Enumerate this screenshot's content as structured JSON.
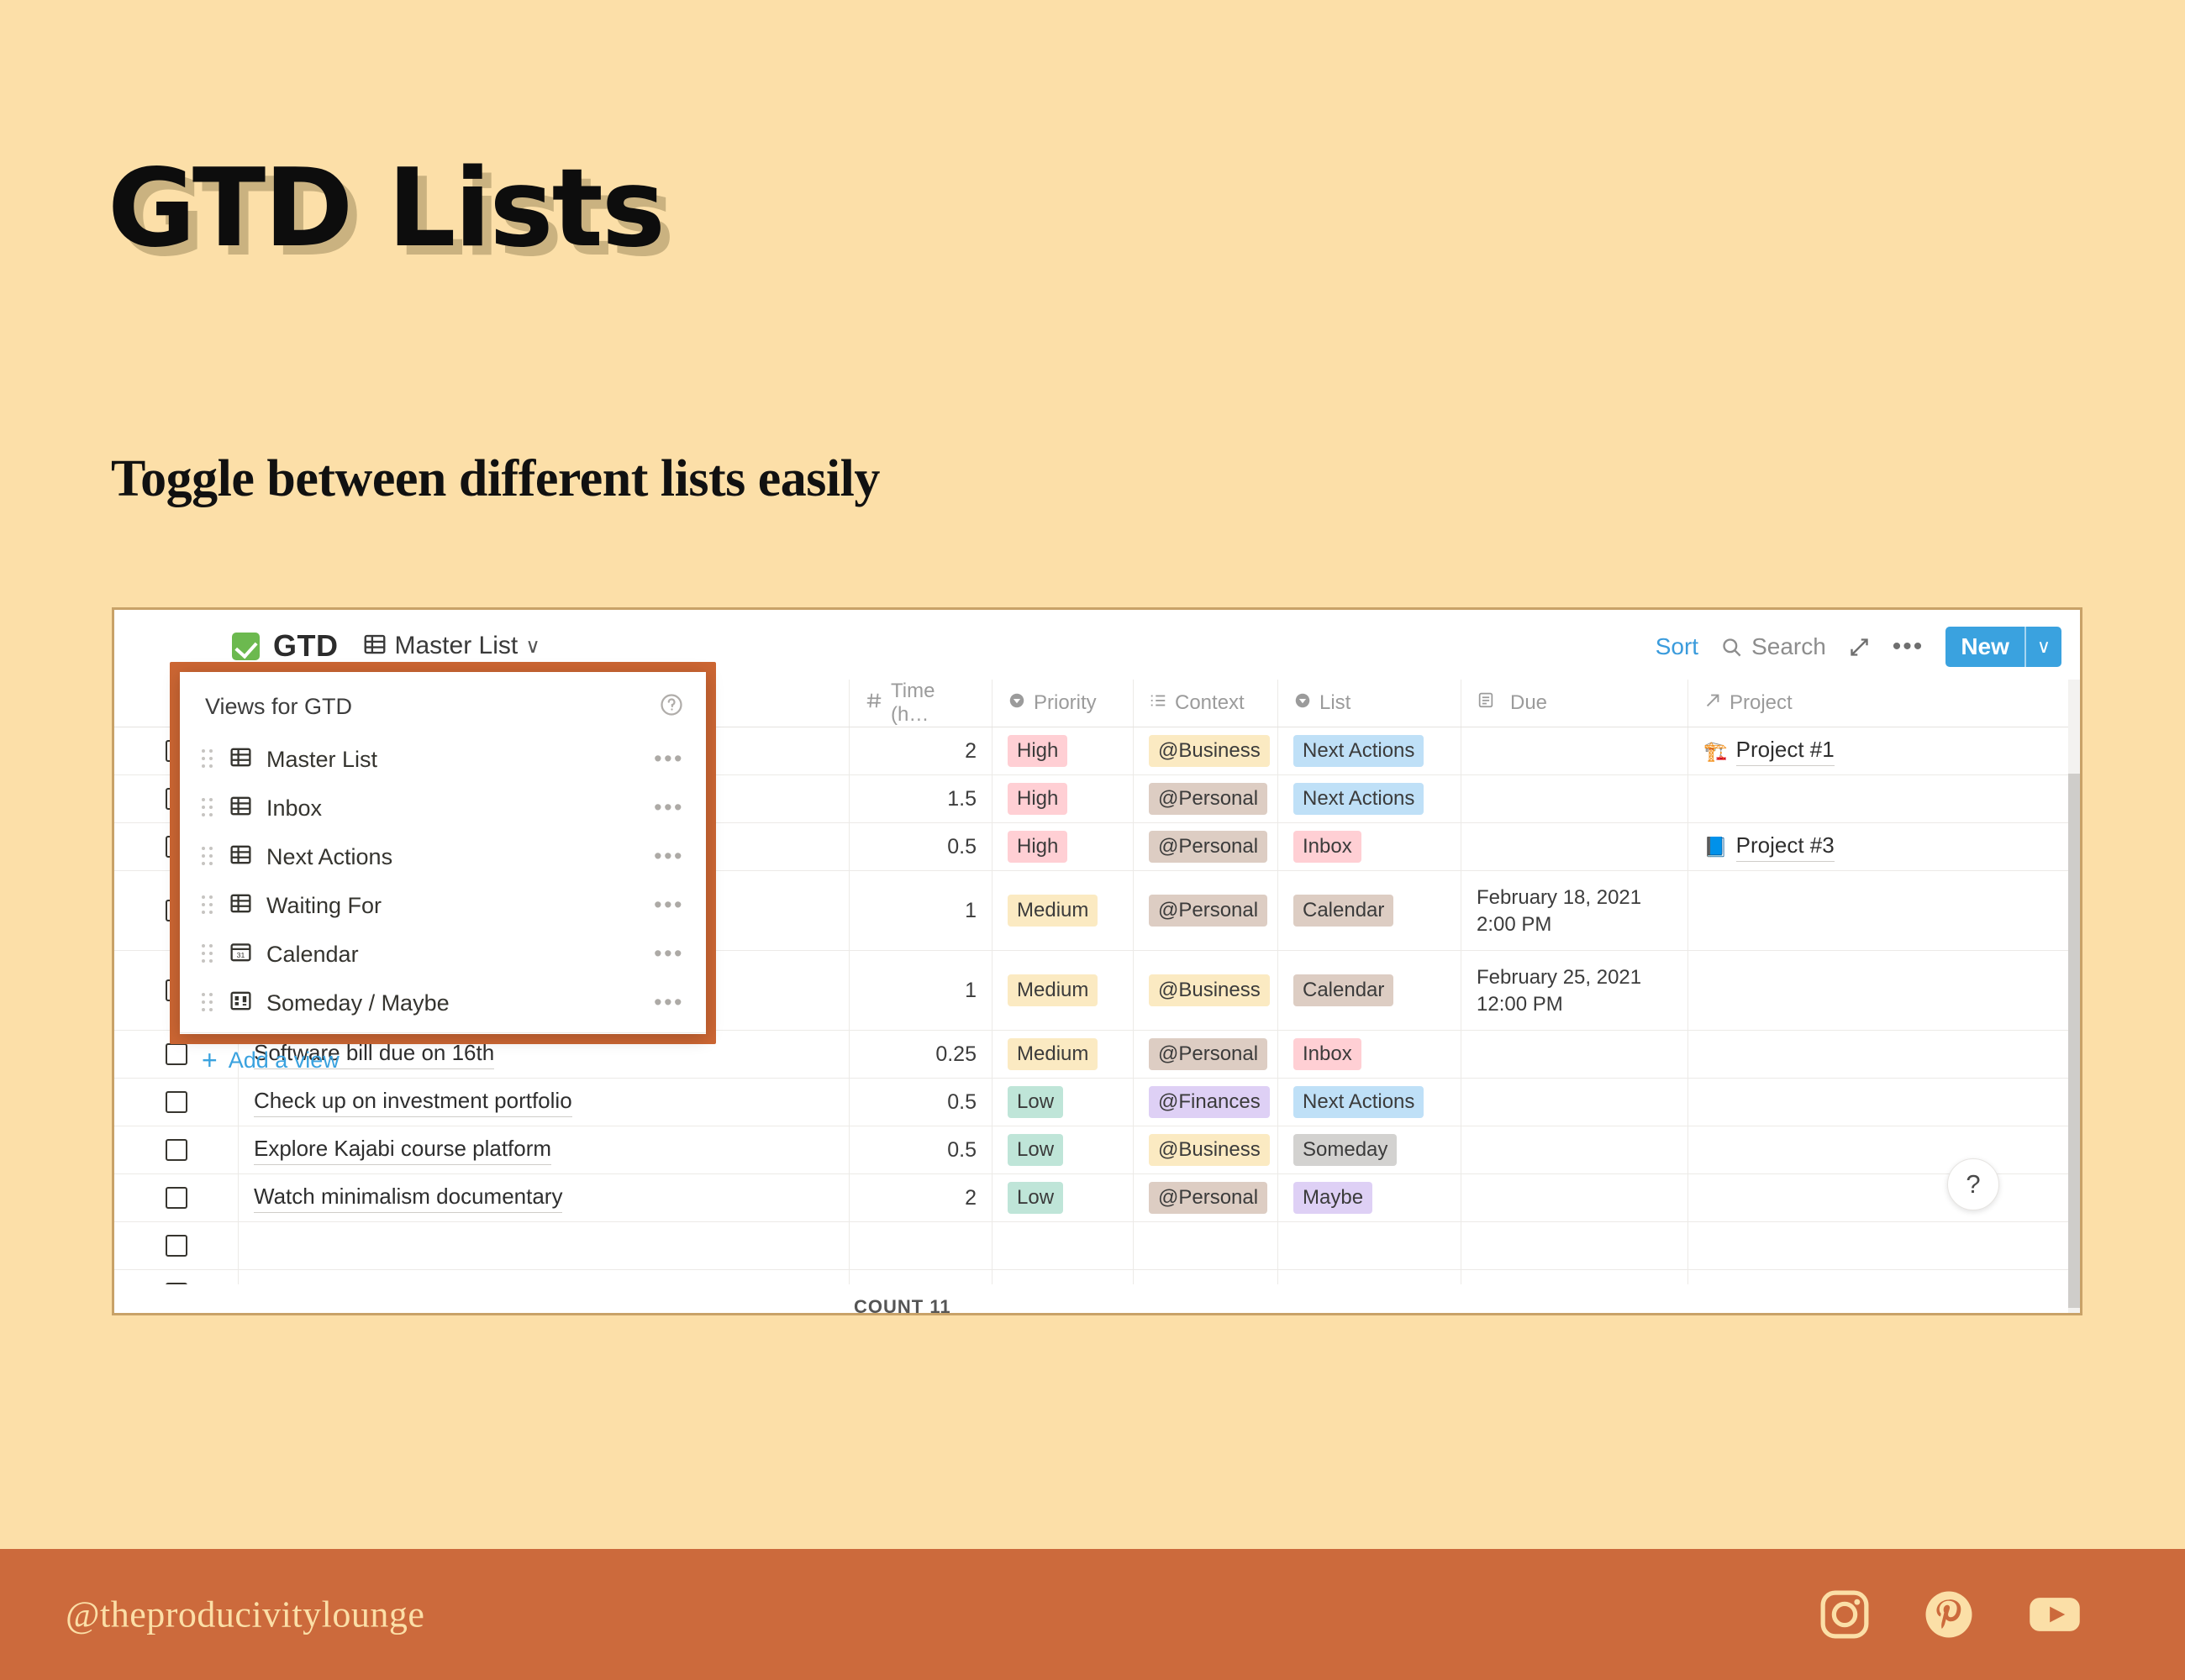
{
  "slide": {
    "title": "GTD Lists",
    "subtitle": "Toggle between different lists easily",
    "background_color": "#fcdfa8",
    "footer_color": "#cc6a3c",
    "highlight_color": "#cc6633"
  },
  "app": {
    "db_emoji": "white-check-mark",
    "db_title": "GTD",
    "current_view": "Master List",
    "view_caret": "∨"
  },
  "toolbar": {
    "sort_label": "Sort",
    "search_label": "Search",
    "expand_icon": "expand-arrows-icon",
    "more_label": "•••",
    "new_label": "New",
    "new_caret": "∨"
  },
  "views_dropdown": {
    "heading": "Views for GTD",
    "help_icon": "question-circle-icon",
    "items": [
      {
        "label": "Master List",
        "icon": "table-view-icon",
        "menu": "•••"
      },
      {
        "label": "Inbox",
        "icon": "table-view-icon",
        "menu": "•••"
      },
      {
        "label": "Next Actions",
        "icon": "table-view-icon",
        "menu": "•••"
      },
      {
        "label": "Waiting For",
        "icon": "table-view-icon",
        "menu": "•••"
      },
      {
        "label": "Calendar",
        "icon": "calendar-view-icon",
        "menu": "•••"
      },
      {
        "label": "Someday / Maybe",
        "icon": "board-view-icon",
        "menu": "•••"
      }
    ],
    "add_view_label": "Add a view",
    "add_view_plus": "+"
  },
  "table": {
    "columns": [
      {
        "label": "",
        "icon": ""
      },
      {
        "label": "",
        "icon": ""
      },
      {
        "label": "Time (h…",
        "icon": "number-icon"
      },
      {
        "label": "Priority",
        "icon": "select-icon"
      },
      {
        "label": "Context",
        "icon": "multiselect-icon"
      },
      {
        "label": "List",
        "icon": "select-icon"
      },
      {
        "label": "Due",
        "icon": "date-icon"
      },
      {
        "label": "Project",
        "icon": "relation-icon"
      }
    ],
    "rows": [
      {
        "name": "",
        "hidden_name": true,
        "time": "2",
        "priority": "High",
        "priority_color": "tg-pink",
        "context": "@Business",
        "context_color": "tg-yellow",
        "list": "Next Actions",
        "list_color": "tg-blue",
        "due": "",
        "project": "Project #1",
        "project_emoji": "🏗️",
        "tall": false
      },
      {
        "name": "",
        "hidden_name": true,
        "time": "1.5",
        "priority": "High",
        "priority_color": "tg-pink",
        "context": "@Personal",
        "context_color": "tg-brown",
        "list": "Next Actions",
        "list_color": "tg-blue",
        "due": "",
        "project": "",
        "project_emoji": "",
        "tall": false
      },
      {
        "name": "",
        "hidden_name": true,
        "time": "0.5",
        "priority": "High",
        "priority_color": "tg-pink",
        "context": "@Personal",
        "context_color": "tg-brown",
        "list": "Inbox",
        "list_color": "tg-pink",
        "due": "",
        "project": "Project #3",
        "project_emoji": "📘",
        "tall": false
      },
      {
        "name": "",
        "hidden_name": true,
        "time": "1",
        "priority": "Medium",
        "priority_color": "tg-yellow",
        "context": "@Personal",
        "context_color": "tg-brown",
        "list": "Calendar",
        "list_color": "tg-brown",
        "due": "February 18, 2021 2:00 PM",
        "project": "",
        "project_emoji": "",
        "tall": true
      },
      {
        "name": "",
        "hidden_name": true,
        "time": "1",
        "priority": "Medium",
        "priority_color": "tg-yellow",
        "context": "@Business",
        "context_color": "tg-yellow",
        "list": "Calendar",
        "list_color": "tg-brown",
        "due": "February 25, 2021 12:00 PM",
        "project": "",
        "project_emoji": "",
        "tall": true
      },
      {
        "name": "Software bill due on 16th",
        "hidden_name": false,
        "time": "0.25",
        "priority": "Medium",
        "priority_color": "tg-yellow",
        "context": "@Personal",
        "context_color": "tg-brown",
        "list": "Inbox",
        "list_color": "tg-pink",
        "due": "",
        "project": "",
        "project_emoji": "",
        "tall": false
      },
      {
        "name": "Check up on investment portfolio",
        "hidden_name": false,
        "time": "0.5",
        "priority": "Low",
        "priority_color": "tg-green",
        "context": "@Finances",
        "context_color": "tg-purple",
        "list": "Next Actions",
        "list_color": "tg-blue",
        "due": "",
        "project": "",
        "project_emoji": "",
        "tall": false
      },
      {
        "name": "Explore Kajabi course platform",
        "hidden_name": false,
        "time": "0.5",
        "priority": "Low",
        "priority_color": "tg-green",
        "context": "@Business",
        "context_color": "tg-yellow",
        "list": "Someday",
        "list_color": "tg-gray",
        "due": "",
        "project": "",
        "project_emoji": "",
        "tall": false
      },
      {
        "name": "Watch minimalism documentary",
        "hidden_name": false,
        "time": "2",
        "priority": "Low",
        "priority_color": "tg-green",
        "context": "@Personal",
        "context_color": "tg-brown",
        "list": "Maybe",
        "list_color": "tg-purple",
        "due": "",
        "project": "",
        "project_emoji": "",
        "tall": false
      },
      {
        "name": "",
        "hidden_name": false,
        "time": "",
        "priority": "",
        "priority_color": "",
        "context": "",
        "context_color": "",
        "list": "",
        "list_color": "",
        "due": "",
        "project": "",
        "project_emoji": "",
        "tall": false
      },
      {
        "name": "",
        "hidden_name": false,
        "time": "",
        "priority": "",
        "priority_color": "",
        "context": "",
        "context_color": "",
        "list": "",
        "list_color": "",
        "due": "",
        "project": "",
        "project_emoji": "",
        "tall": false
      }
    ],
    "count_label": "COUNT 11",
    "help_label": "?"
  },
  "footer": {
    "handle": "@theproducivitylounge",
    "socials": [
      "instagram-icon",
      "pinterest-icon",
      "youtube-icon"
    ]
  }
}
